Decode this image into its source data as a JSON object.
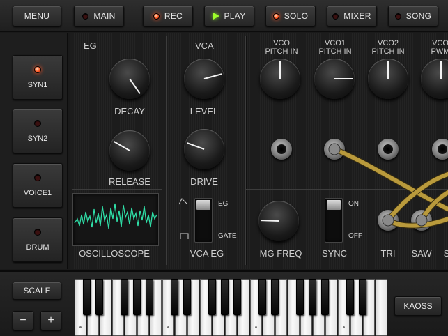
{
  "toolbar": {
    "menu": "MENU",
    "main": "MAIN",
    "rec": "REC",
    "play": "PLAY",
    "solo": "SOLO",
    "mixer": "MIXER",
    "song": "SONG"
  },
  "voices": [
    {
      "label": "SYN1",
      "led": "on"
    },
    {
      "label": "SYN2",
      "led": "off"
    },
    {
      "label": "VOICE1",
      "led": "off"
    },
    {
      "label": "DRUM",
      "led": "off"
    }
  ],
  "eg": {
    "title": "EG",
    "decay": "DECAY",
    "release": "RELEASE"
  },
  "vca": {
    "title": "VCA",
    "level": "LEVEL",
    "drive": "DRIVE",
    "vca_eg": "VCA EG",
    "eg_opt": "EG",
    "gate_opt": "GATE"
  },
  "vco": {
    "pitch_in": "VCO\nPITCH IN",
    "vco1_pitch_in": "VCO1\nPITCH IN",
    "vco2_pitch_in": "VCO2\nPITCH IN",
    "pwm": "VCO\nPWM"
  },
  "mg": {
    "freq": "MG FREQ",
    "sync": "SYNC",
    "on": "ON",
    "off": "OFF",
    "tri": "TRI",
    "saw": "SAW",
    "sq": "S"
  },
  "scope": {
    "label": "OSCILLOSCOPE"
  },
  "bottom": {
    "scale": "SCALE",
    "minus": "−",
    "plus": "+",
    "kaoss": "KAOSS"
  },
  "colors": {
    "led_on": "#ff5a25",
    "play_on": "#9eff2a",
    "scope_wave": "#2fe0a8",
    "cable": "#b99a3c"
  }
}
